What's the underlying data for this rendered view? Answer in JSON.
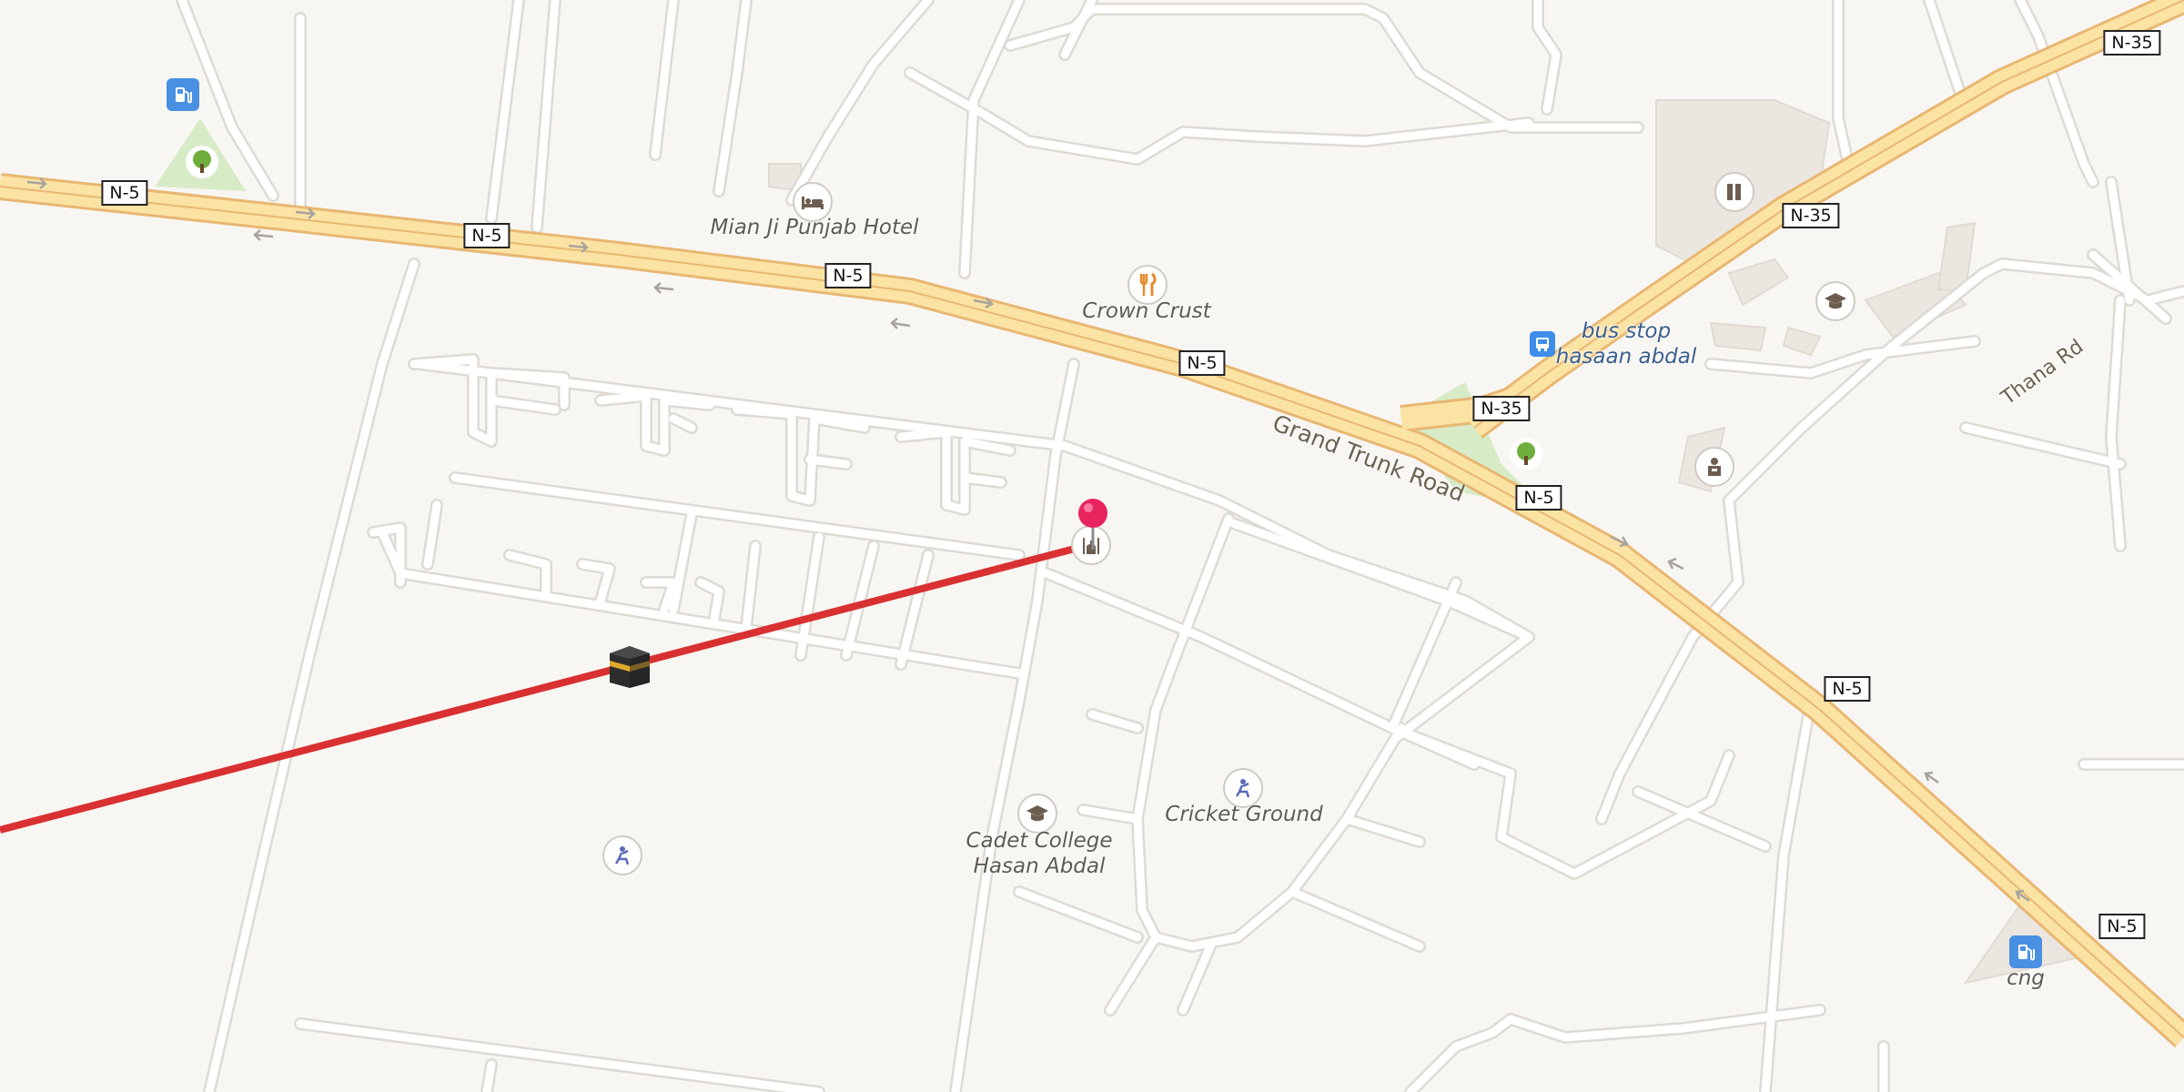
{
  "colors": {
    "background": "#f8f6f3",
    "minor_road": "#ffffff",
    "minor_road_casing": "#dedad4",
    "highway_fill": "#fbe3a4",
    "highway_casing": "#e8b772",
    "park": "#d7ebc7",
    "building": "#ebe6df",
    "qibla_line": "#d93032",
    "pin": "#e8245f"
  },
  "road_shields": {
    "n5_a": "N-5",
    "n5_b": "N-5",
    "n5_c": "N-5",
    "n5_d": "N-5",
    "n5_e": "N-5",
    "n5_f": "N-5",
    "n5_g": "N-5",
    "n35_a": "N-35",
    "n35_b": "N-35",
    "n35_c": "N-35"
  },
  "road_names": {
    "grand_trunk": "Grand Trunk Road",
    "thana": "Thana Rd"
  },
  "pois": {
    "hotel": "Mian Ji Punjab Hotel",
    "restaurant": "Crown Crust",
    "bus_stop": "bus stop\nhasaan abdal",
    "cricket": "Cricket Ground",
    "college": "Cadet College\nHasan Abdal",
    "fuel": "cng"
  },
  "icons": {
    "fuel_top": "fuel-station-icon",
    "fuel_bottom": "fuel-station-icon",
    "park_1": "tree-icon",
    "park_2": "tree-icon",
    "hotel": "bed-icon",
    "restaurant": "fork-knife-icon",
    "bus": "bus-icon",
    "school_1": "graduation-cap-icon",
    "school_2": "graduation-cap-icon",
    "mosque": "mosque-icon",
    "kaaba": "kaaba-icon",
    "pin": "location-pin-icon",
    "sports_1": "sports-icon",
    "sports_2": "sports-icon",
    "shop": "shop-icon",
    "office": "office-icon"
  }
}
